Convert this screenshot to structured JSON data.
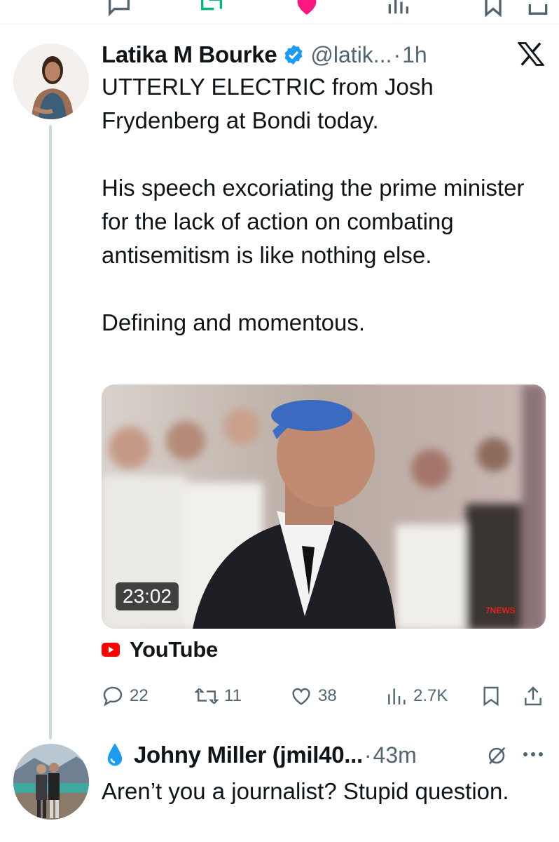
{
  "tweet": {
    "author_name": "Latika M Bourke",
    "handle": "@latik...",
    "separator": "·",
    "time": "1h",
    "paragraphs": [
      "UTTERLY ELECTRIC from Josh Frydenberg at Bondi today.",
      "His speech excoriating the prime minister for the lack of action on combating antisemitism is like nothing else.",
      "Defining and momentous."
    ],
    "video_duration": "23:02",
    "video_watermark": "7NEWS",
    "link_source": "YouTube",
    "stats": {
      "replies": "22",
      "reposts": "11",
      "likes": "38",
      "views": "2.7K"
    }
  },
  "reply": {
    "author_name": "Johny Miller (jmil40...",
    "separator": "·",
    "time": "43m",
    "text": "Aren’t you a journalist? Stupid question."
  },
  "colors": {
    "verified": "#1d9bf0",
    "youtube": "#ff0000",
    "muted": "#536471",
    "thread_line": "#cfd9de",
    "drop": "#1d9bf0"
  }
}
